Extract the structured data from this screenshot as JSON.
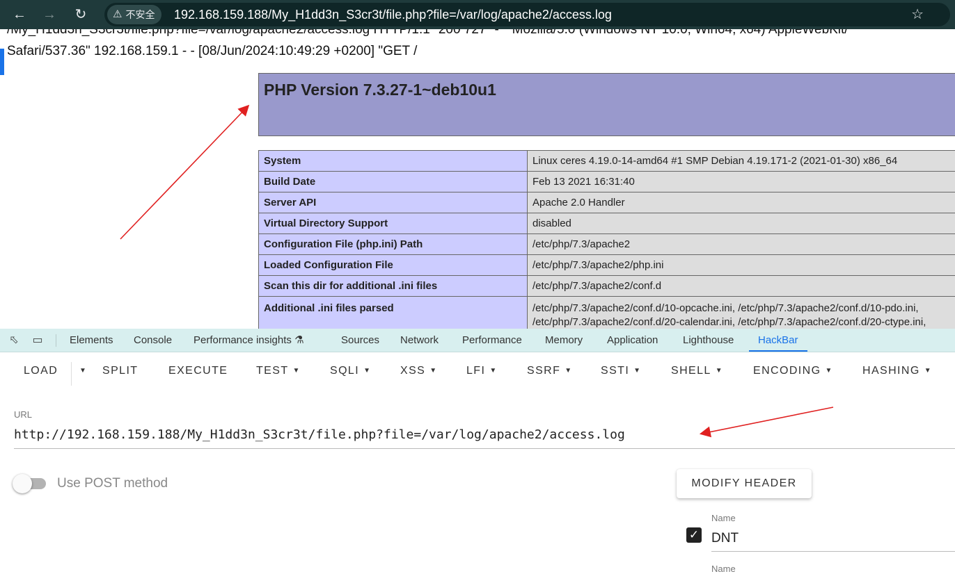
{
  "browser": {
    "security_label": "不安全",
    "url": "192.168.159.188/My_H1dd3n_S3cr3t/file.php?file=/var/log/apache2/access.log"
  },
  "page": {
    "log_line_cut": "/My_H1dd3n_S3cr3t/file.php?file=/var/log/apache2/access.log HTTP/1.1\" 200 727 \"-\" \"Mozilla/5.0 (Windows NT 10.0; Win64; x64) AppleWebKit/",
    "log_line_2": "Safari/537.36\" 192.168.159.1 - - [08/Jun/2024:10:49:29 +0200] \"GET /",
    "php_version_title": "PHP Version 7.3.27-1~deb10u1",
    "phpinfo_rows": [
      {
        "key": "System",
        "value": "Linux ceres 4.19.0-14-amd64 #1 SMP Debian 4.19.171-2 (2021-01-30) x86_64"
      },
      {
        "key": "Build Date",
        "value": "Feb 13 2021 16:31:40"
      },
      {
        "key": "Server API",
        "value": "Apache 2.0 Handler"
      },
      {
        "key": "Virtual Directory Support",
        "value": "disabled"
      },
      {
        "key": "Configuration File (php.ini) Path",
        "value": "/etc/php/7.3/apache2"
      },
      {
        "key": "Loaded Configuration File",
        "value": "/etc/php/7.3/apache2/php.ini"
      },
      {
        "key": "Scan this dir for additional .ini files",
        "value": "/etc/php/7.3/apache2/conf.d"
      },
      {
        "key": "Additional .ini files parsed",
        "value": "/etc/php/7.3/apache2/conf.d/10-opcache.ini, /etc/php/7.3/apache2/conf.d/10-pdo.ini,",
        "value2": "/etc/php/7.3/apache2/conf.d/20-calendar.ini, /etc/php/7.3/apache2/conf.d/20-ctype.ini,"
      }
    ]
  },
  "devtools": {
    "tabs": [
      "Elements",
      "Console",
      "Performance insights",
      "Sources",
      "Network",
      "Performance",
      "Memory",
      "Application",
      "Lighthouse",
      "HackBar"
    ],
    "active_tab": "HackBar"
  },
  "hackbar": {
    "buttons": [
      "LOAD",
      "SPLIT",
      "EXECUTE",
      "TEST",
      "SQLI",
      "XSS",
      "LFI",
      "SSRF",
      "SSTI",
      "SHELL",
      "ENCODING",
      "HASHING"
    ],
    "url_label": "URL",
    "url_value": "http://192.168.159.188/My_H1dd3n_S3cr3t/file.php?file=/var/log/apache2/access.log",
    "post_label": "Use POST method",
    "post_enabled": false,
    "modify_header_label": "MODIFY HEADER",
    "header_name_label": "Name",
    "header_name_value": "DNT",
    "header_name_label_2": "Name"
  },
  "colors": {
    "chrome_bg": "#1f3a3b",
    "php_header": "#9999cc",
    "php_key": "#ccccff",
    "php_value": "#dddddd",
    "devtools_accent": "#1a73e8",
    "annotation_arrow": "#e02020"
  }
}
